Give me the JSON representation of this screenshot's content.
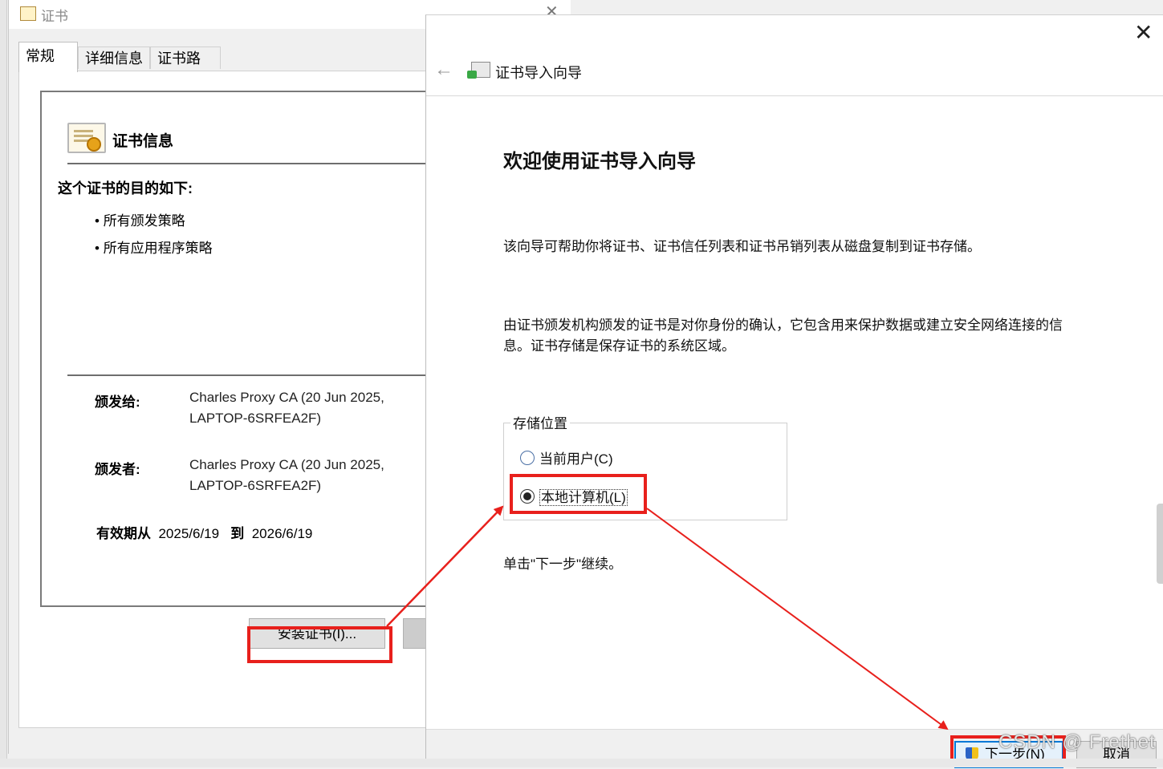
{
  "cert_dialog": {
    "window_title": "证书",
    "tabs": [
      {
        "label": "常规",
        "active": true
      },
      {
        "label": "详细信息",
        "active": false
      },
      {
        "label": "证书路径",
        "active": false
      }
    ],
    "info_title": "证书信息",
    "purpose_heading": "这个证书的目的如下:",
    "purposes": [
      "所有颁发策略",
      "所有应用程序策略"
    ],
    "issued_to_label": "颁发给:",
    "issued_to_value": [
      "Charles Proxy CA (20 Jun 2025,",
      "LAPTOP-6SRFEA2F)"
    ],
    "issued_by_label": "颁发者:",
    "issued_by_value": [
      "Charles Proxy CA (20 Jun 2025,",
      "LAPTOP-6SRFEA2F)"
    ],
    "validity_from_label": "有效期从",
    "validity_from": "2025/6/19",
    "validity_to_label": "到",
    "validity_to": "2026/6/19",
    "install_button": "安装证书(I)..."
  },
  "wizard": {
    "title": "证书导入向导",
    "heading": "欢迎使用证书导入向导",
    "para1": "该向导可帮助你将证书、证书信任列表和证书吊销列表从磁盘复制到证书存储。",
    "para2_line1": "由证书颁发机构颁发的证书是对你身份的确认，它包含用来保护数据或建立安全网络连接的信",
    "para2_line2": "息。证书存储是保存证书的系统区域。",
    "store_location_legend": "存储位置",
    "options": [
      {
        "label": "当前用户(C)",
        "checked": false
      },
      {
        "label": "本地计算机(L)",
        "checked": true
      }
    ],
    "hint": "单击\"下一步\"继续。",
    "next_button": "下一步(N)",
    "cancel_button": "取消"
  },
  "watermark": "CSDN @ Frethet",
  "colors": {
    "highlight_red": "#e8201c",
    "primary_button_border": "#0078d7"
  }
}
